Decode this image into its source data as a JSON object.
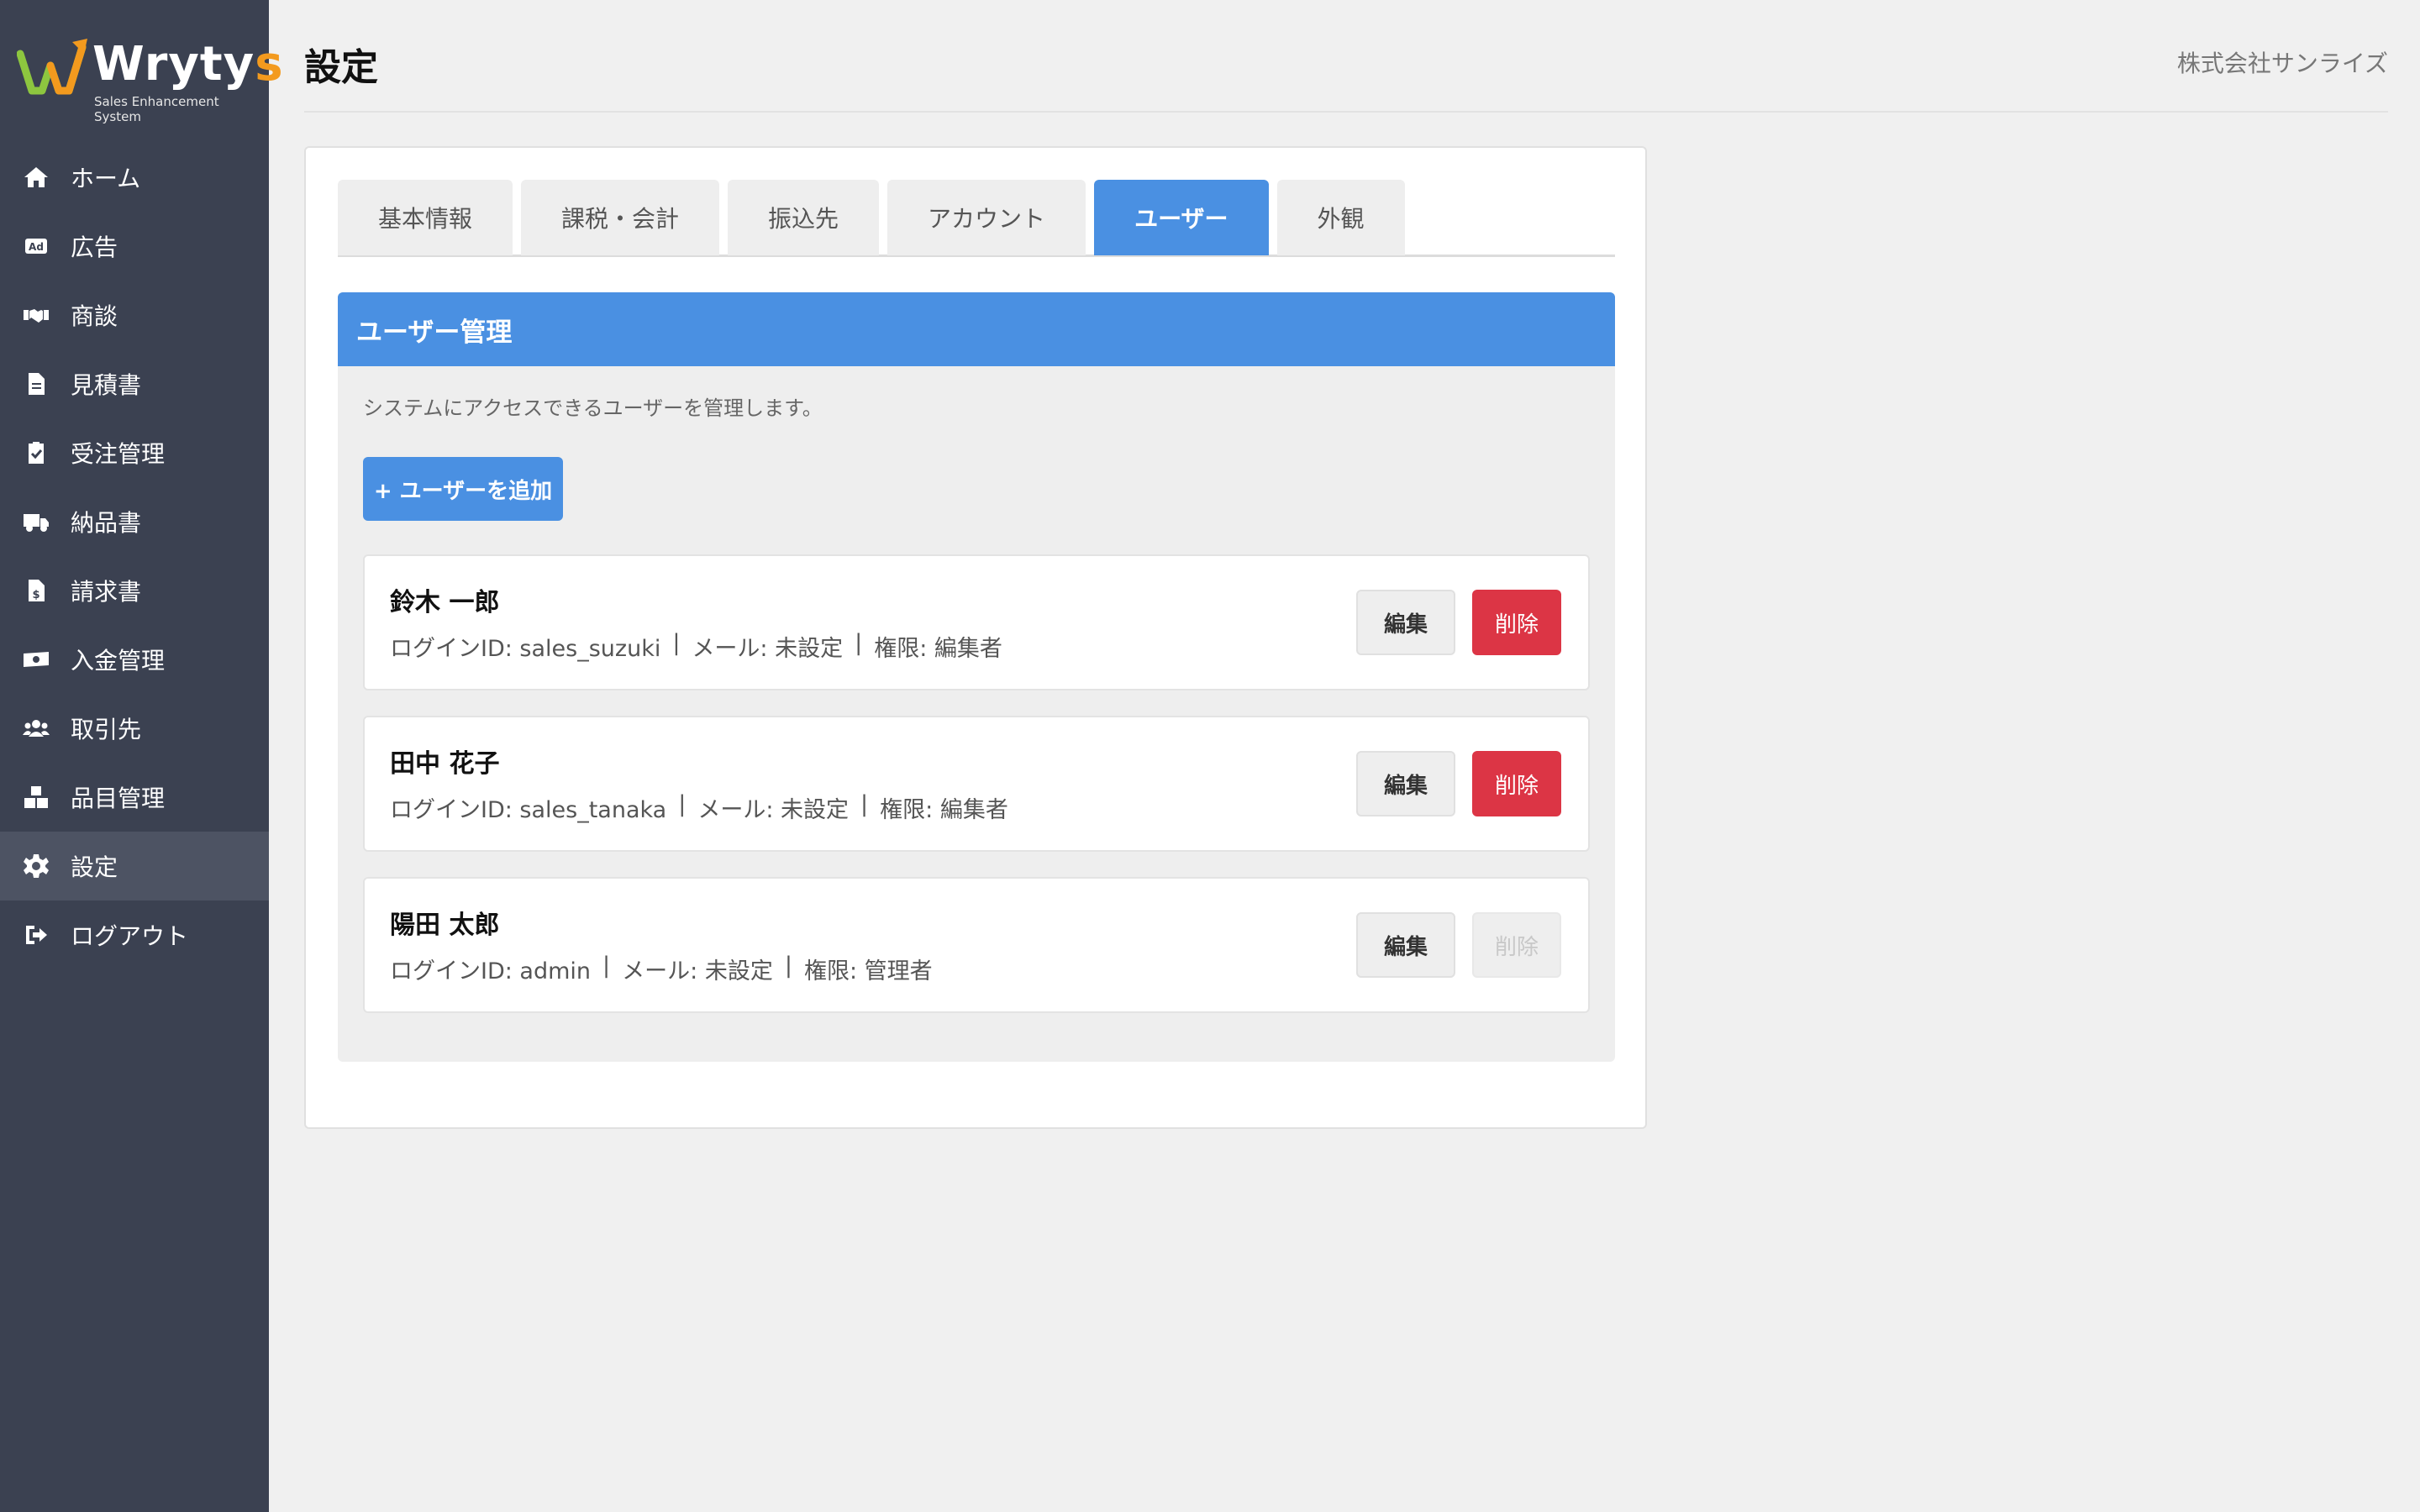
{
  "app": {
    "brand_main": "Wryty",
    "brand_accent": "s",
    "brand_sub": "Sales Enhancement System"
  },
  "sidebar": {
    "items": [
      {
        "label": "ホーム",
        "icon": "home-icon"
      },
      {
        "label": "広告",
        "icon": "ad-icon"
      },
      {
        "label": "商談",
        "icon": "handshake-icon"
      },
      {
        "label": "見積書",
        "icon": "document-icon"
      },
      {
        "label": "受注管理",
        "icon": "clipboard-check-icon"
      },
      {
        "label": "納品書",
        "icon": "truck-icon"
      },
      {
        "label": "請求書",
        "icon": "invoice-icon"
      },
      {
        "label": "入金管理",
        "icon": "money-icon"
      },
      {
        "label": "取引先",
        "icon": "users-icon"
      },
      {
        "label": "品目管理",
        "icon": "boxes-icon"
      },
      {
        "label": "設定",
        "icon": "gear-icon",
        "active": true
      },
      {
        "label": "ログアウト",
        "icon": "logout-icon"
      }
    ]
  },
  "header": {
    "title": "設定",
    "company": "株式会社サンライズ"
  },
  "tabs": [
    {
      "label": "基本情報"
    },
    {
      "label": "課税・会計"
    },
    {
      "label": "振込先"
    },
    {
      "label": "アカウント"
    },
    {
      "label": "ユーザー",
      "active": true
    },
    {
      "label": "外観"
    }
  ],
  "panel": {
    "title": "ユーザー管理",
    "description": "システムにアクセスできるユーザーを管理します。",
    "add_button": "+ ユーザーを追加"
  },
  "users": [
    {
      "name": "鈴木 一郎",
      "login": "ログインID: sales_suzuki",
      "mail": "メール: 未設定",
      "role": "権限: 編集者",
      "edit": "編集",
      "delete": "削除",
      "delete_enabled": true
    },
    {
      "name": "田中 花子",
      "login": "ログインID: sales_tanaka",
      "mail": "メール: 未設定",
      "role": "権限: 編集者",
      "edit": "編集",
      "delete": "削除",
      "delete_enabled": true
    },
    {
      "name": "陽田 太郎",
      "login": "ログインID: admin",
      "mail": "メール: 未設定",
      "role": "権限: 管理者",
      "edit": "編集",
      "delete": "削除",
      "delete_enabled": false
    }
  ],
  "colors": {
    "sidebar_bg": "#3b4151",
    "accent": "#4a90e2",
    "danger": "#dc3545",
    "brand_orange": "#f39a1e"
  }
}
